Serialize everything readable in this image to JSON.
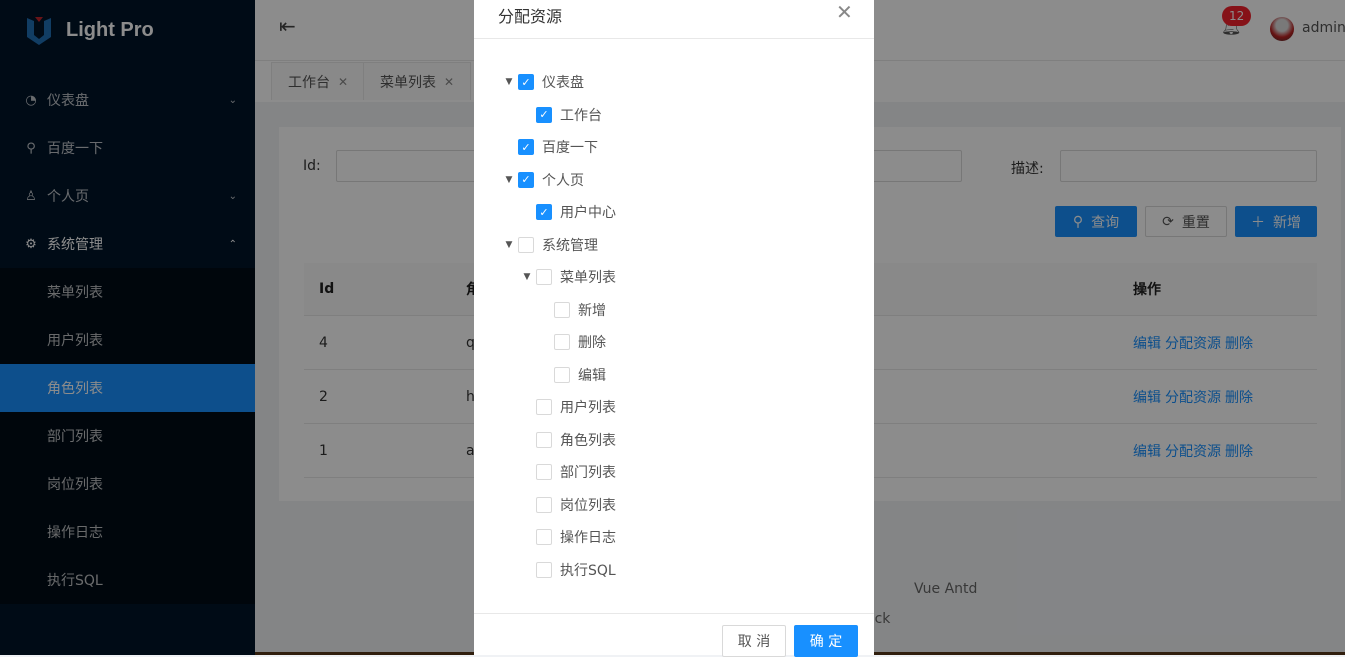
{
  "app": {
    "title": "Light Pro"
  },
  "colors": {
    "primary": "#1890ff",
    "sider": "#001529",
    "badge": "#f5222d"
  },
  "sidebar": {
    "items": [
      {
        "label": "仪表盘",
        "icon": "dashboard-icon",
        "expandable": true
      },
      {
        "label": "百度一下",
        "icon": "search-icon"
      },
      {
        "label": "个人页",
        "icon": "user-icon",
        "expandable": true
      },
      {
        "label": "系统管理",
        "icon": "setting-icon",
        "expandable": true,
        "expanded": true
      }
    ],
    "sub_items": [
      {
        "label": "菜单列表"
      },
      {
        "label": "用户列表"
      },
      {
        "label": "角色列表",
        "active": true
      },
      {
        "label": "部门列表"
      },
      {
        "label": "岗位列表"
      },
      {
        "label": "操作日志"
      },
      {
        "label": "执行SQL"
      }
    ]
  },
  "header": {
    "notifications": "12",
    "username": "admin"
  },
  "tabs": [
    {
      "label": "工作台"
    },
    {
      "label": "菜单列表"
    }
  ],
  "search": {
    "id_label": "Id:",
    "desc_label": "描述:",
    "query": "查询",
    "reset": "重置",
    "add": "新增"
  },
  "table": {
    "headers": [
      "Id",
      "角",
      "操作"
    ],
    "rows": [
      {
        "id": "4",
        "name": "q"
      },
      {
        "id": "2",
        "name": "h"
      },
      {
        "id": "1",
        "name": "a"
      }
    ],
    "actions": {
      "edit": "编辑",
      "assign": "分配资源",
      "delete": "删除"
    }
  },
  "footer": {
    "line1": "Vue Antd",
    "line2": "ack"
  },
  "modal": {
    "title": "分配资源",
    "cancel": "取 消",
    "ok": "确 定",
    "tree": [
      {
        "label": "仪表盘",
        "level": 0,
        "expanded": true,
        "checked": true
      },
      {
        "label": "工作台",
        "level": 1,
        "checked": true
      },
      {
        "label": "百度一下",
        "level": 0,
        "checked": true
      },
      {
        "label": "个人页",
        "level": 0,
        "expanded": true,
        "checked": true
      },
      {
        "label": "用户中心",
        "level": 1,
        "checked": true
      },
      {
        "label": "系统管理",
        "level": 0,
        "expanded": true,
        "checked": false
      },
      {
        "label": "菜单列表",
        "level": 1,
        "expanded": true,
        "checked": false
      },
      {
        "label": "新增",
        "level": 2,
        "checked": false
      },
      {
        "label": "删除",
        "level": 2,
        "checked": false
      },
      {
        "label": "编辑",
        "level": 2,
        "checked": false
      },
      {
        "label": "用户列表",
        "level": 1,
        "checked": false
      },
      {
        "label": "角色列表",
        "level": 1,
        "checked": false
      },
      {
        "label": "部门列表",
        "level": 1,
        "checked": false
      },
      {
        "label": "岗位列表",
        "level": 1,
        "checked": false
      },
      {
        "label": "操作日志",
        "level": 1,
        "checked": false
      },
      {
        "label": "执行SQL",
        "level": 1,
        "checked": false
      }
    ]
  }
}
